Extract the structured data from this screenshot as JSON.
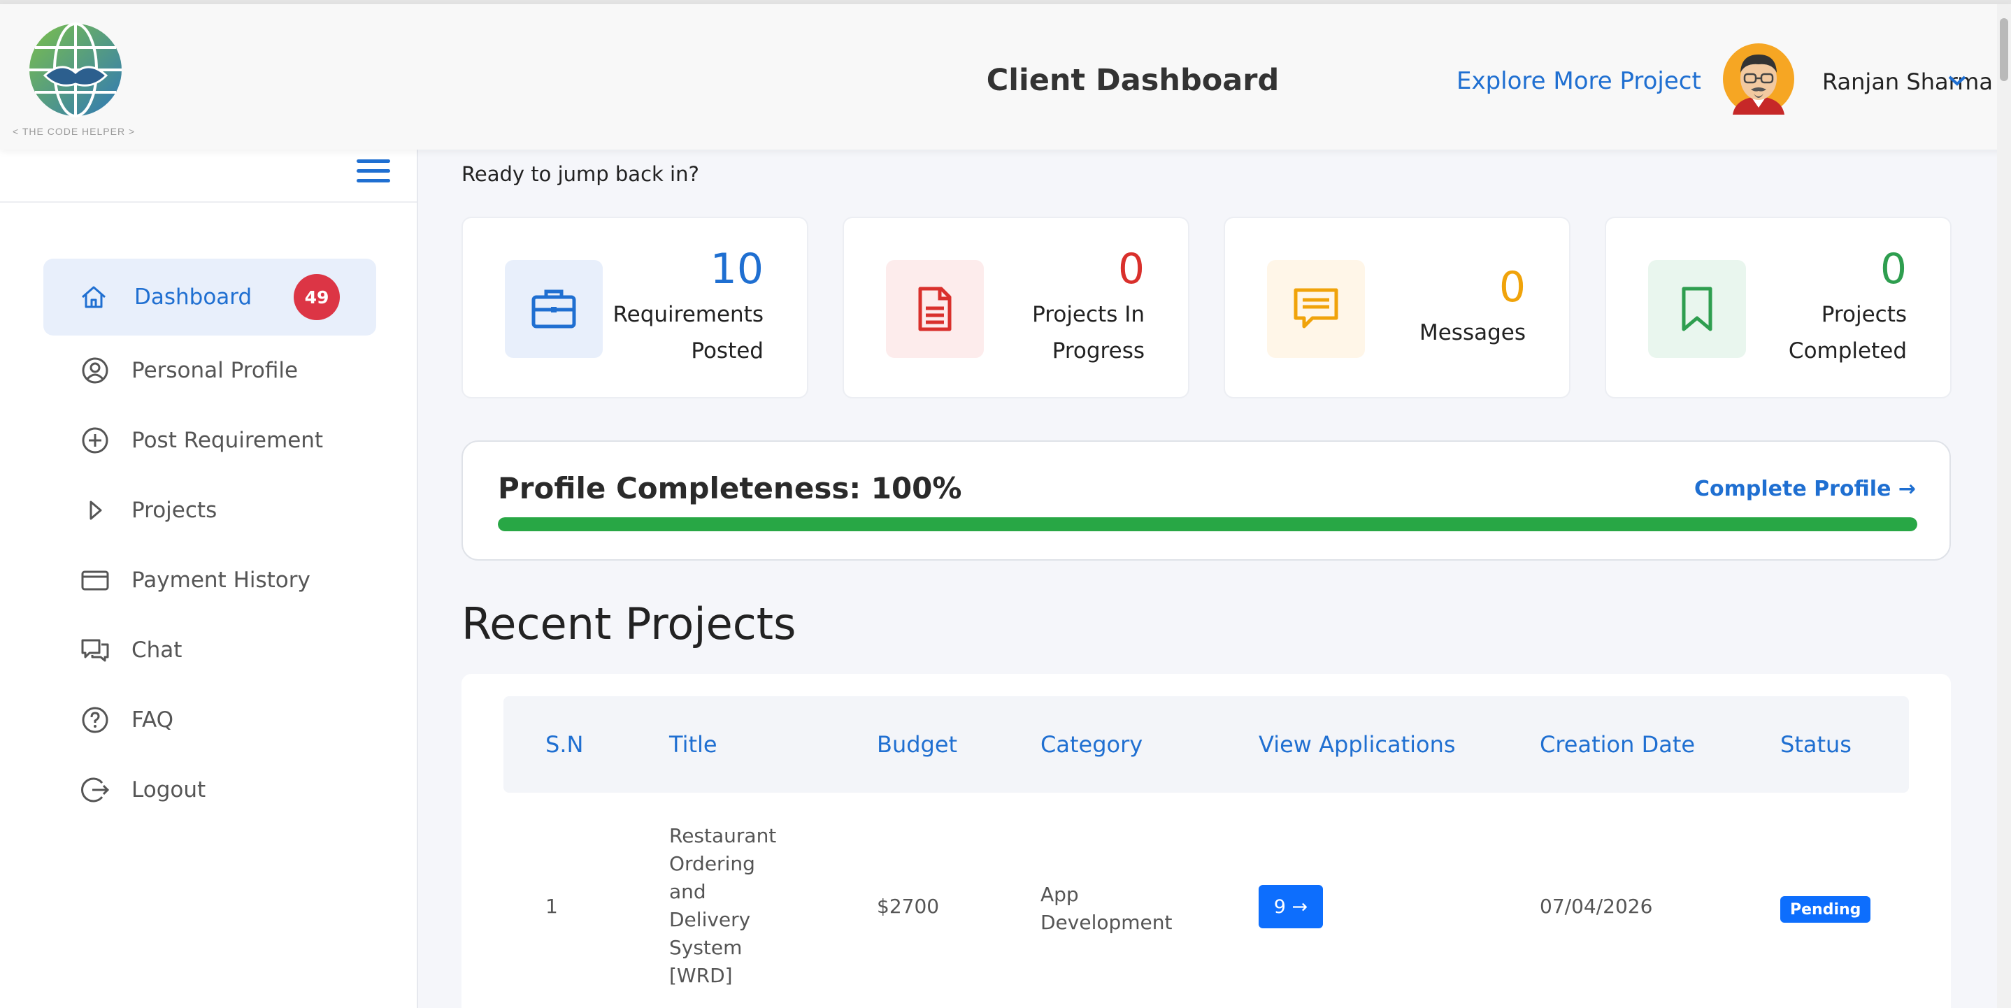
{
  "brand": {
    "logo_caption": "< THE CODE HELPER >"
  },
  "header": {
    "title": "Client Dashboard",
    "explore_link": "Explore More Project",
    "user_name": "Ranjan Sharma"
  },
  "sidebar": {
    "items": [
      {
        "label": "Dashboard",
        "icon": "home-icon",
        "badge": "49",
        "active": true
      },
      {
        "label": "Personal Profile",
        "icon": "user-circle-icon"
      },
      {
        "label": "Post Requirement",
        "icon": "plus-circle-icon"
      },
      {
        "label": "Projects",
        "icon": "caret-right-icon"
      },
      {
        "label": "Payment History",
        "icon": "credit-card-icon"
      },
      {
        "label": "Chat",
        "icon": "chat-bubbles-icon"
      },
      {
        "label": "FAQ",
        "icon": "question-circle-icon"
      },
      {
        "label": "Logout",
        "icon": "logout-icon"
      }
    ]
  },
  "greeting": "Ready to jump back in?",
  "stats": [
    {
      "value": "10",
      "label_line1": "Requirements",
      "label_line2": "Posted",
      "icon": "briefcase-icon",
      "color": "#1f6fd1",
      "bg": "#e8effb"
    },
    {
      "value": "0",
      "label_line1": "Projects In",
      "label_line2": "Progress",
      "icon": "document-icon",
      "color": "#d9302c",
      "bg": "#fdecec"
    },
    {
      "value": "0",
      "label_line1": "Messages",
      "label_line2": "",
      "icon": "message-icon",
      "color": "#f0a30a",
      "bg": "#fff6e8"
    },
    {
      "value": "0",
      "label_line1": "Projects",
      "label_line2": "Completed",
      "icon": "bookmark-icon",
      "color": "#2e9e4f",
      "bg": "#e9f6ee"
    }
  ],
  "profile": {
    "title": "Profile Completeness: 100%",
    "link": "Complete Profile →",
    "progress": 1.0,
    "bar_color": "#28a745"
  },
  "recent": {
    "title": "Recent Projects",
    "columns": [
      "S.N",
      "Title",
      "Budget",
      "Category",
      "View Applications",
      "Creation Date",
      "Status"
    ],
    "rows": [
      {
        "sn": "1",
        "title_lines": [
          "Restaurant",
          "Ordering",
          "and",
          "Delivery",
          "System",
          "[WRD]"
        ],
        "budget": "$2700",
        "category_lines": [
          "App",
          "Development"
        ],
        "applications": "9 →",
        "date": "07/04/2026",
        "status": "Pending"
      }
    ]
  }
}
